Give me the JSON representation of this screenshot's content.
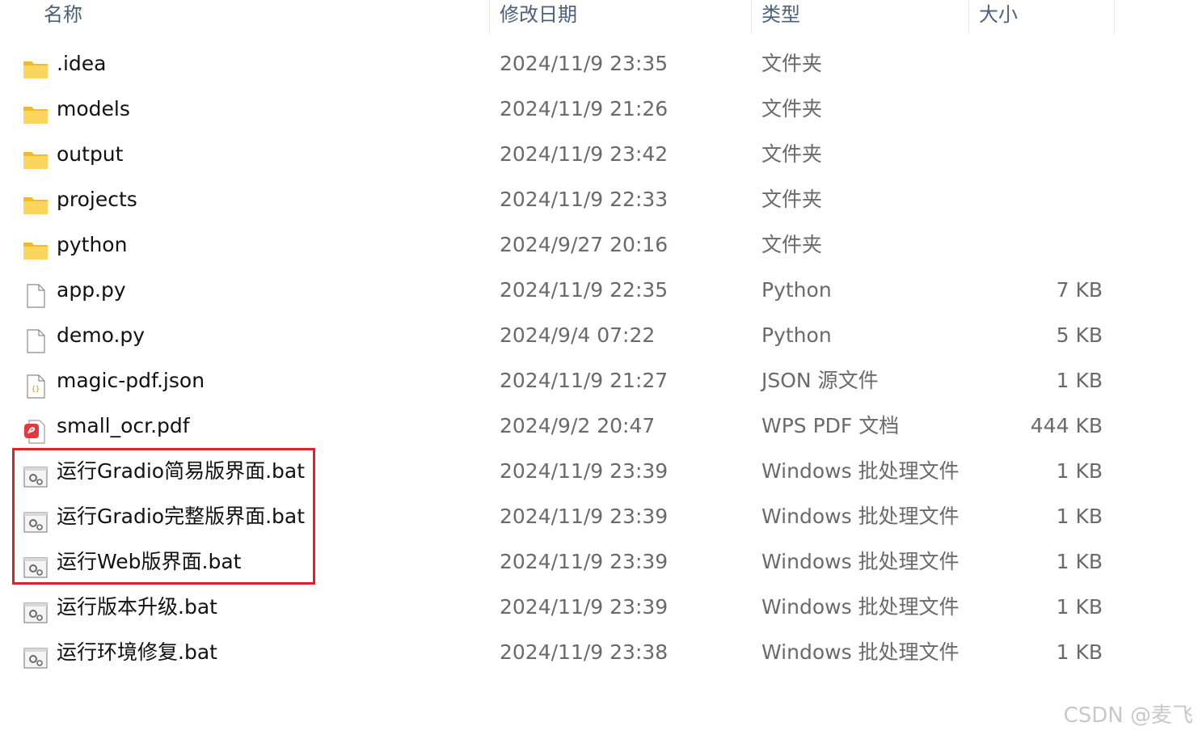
{
  "columns": {
    "name": "名称",
    "date": "修改日期",
    "type": "类型",
    "size": "大小"
  },
  "files": [
    {
      "name": ".idea",
      "date": "2024/11/9 23:35",
      "type": "文件夹",
      "size": "",
      "icon": "folder-icon"
    },
    {
      "name": "models",
      "date": "2024/11/9 21:26",
      "type": "文件夹",
      "size": "",
      "icon": "folder-icon"
    },
    {
      "name": "output",
      "date": "2024/11/9 23:42",
      "type": "文件夹",
      "size": "",
      "icon": "folder-icon"
    },
    {
      "name": "projects",
      "date": "2024/11/9 22:33",
      "type": "文件夹",
      "size": "",
      "icon": "folder-icon"
    },
    {
      "name": "python",
      "date": "2024/9/27 20:16",
      "type": "文件夹",
      "size": "",
      "icon": "folder-icon"
    },
    {
      "name": "app.py",
      "date": "2024/11/9 22:35",
      "type": "Python",
      "size": "7 KB",
      "icon": "file-icon"
    },
    {
      "name": "demo.py",
      "date": "2024/9/4 07:22",
      "type": "Python",
      "size": "5 KB",
      "icon": "file-icon"
    },
    {
      "name": "magic-pdf.json",
      "date": "2024/11/9 21:27",
      "type": "JSON 源文件",
      "size": "1 KB",
      "icon": "json-file-icon"
    },
    {
      "name": "small_ocr.pdf",
      "date": "2024/9/2 20:47",
      "type": "WPS PDF 文档",
      "size": "444 KB",
      "icon": "pdf-file-icon"
    },
    {
      "name": "运行Gradio简易版界面.bat",
      "date": "2024/11/9 23:39",
      "type": "Windows 批处理文件",
      "size": "1 KB",
      "icon": "batch-file-icon"
    },
    {
      "name": "运行Gradio完整版界面.bat",
      "date": "2024/11/9 23:39",
      "type": "Windows 批处理文件",
      "size": "1 KB",
      "icon": "batch-file-icon"
    },
    {
      "name": "运行Web版界面.bat",
      "date": "2024/11/9 23:39",
      "type": "Windows 批处理文件",
      "size": "1 KB",
      "icon": "batch-file-icon"
    },
    {
      "name": "运行版本升级.bat",
      "date": "2024/11/9 23:39",
      "type": "Windows 批处理文件",
      "size": "1 KB",
      "icon": "batch-file-icon"
    },
    {
      "name": "运行环境修复.bat",
      "date": "2024/11/9 23:38",
      "type": "Windows 批处理文件",
      "size": "1 KB",
      "icon": "batch-file-icon"
    }
  ],
  "watermark": "CSDN @麦飞",
  "colors": {
    "highlight": "#e0202a",
    "folder": "#f7c948",
    "header_text": "#4c607a"
  }
}
